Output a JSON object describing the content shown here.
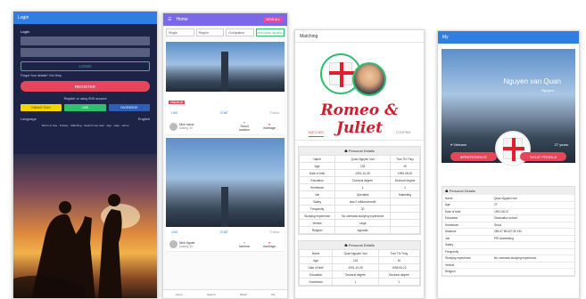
{
  "login": {
    "title": "Login",
    "form_label": "Login",
    "login_button": "LOGIN",
    "forgot_text": "Forgot Your details? Get Help",
    "register_button": "REGISTER",
    "or_text": "Register or using SNS account",
    "social": [
      {
        "label": "KAKAO TALK",
        "color": "#f5d400"
      },
      {
        "label": "LINE",
        "color": "#2fbf71"
      },
      {
        "label": "FACEBOOK",
        "color": "#2f5fb3"
      }
    ],
    "language_label": "Language",
    "language_value": "English",
    "links_text": "Terms of Use · Privacy · Matching · Search Live Cam · App · Help · Home"
  },
  "home": {
    "title": "Home",
    "top_button": "VIEW ALL",
    "filters": [
      "Single",
      "Region",
      "Occupation"
    ],
    "search_button": "MATCHING SEARCH",
    "cards": [
      {
        "tag": "PREMIUM",
        "like": "LIKE",
        "chat": "CHAT",
        "follow": "Follow",
        "user": "Nick name",
        "user_sub": "Dating 30",
        "location": "Seoul",
        "location_sub": "location",
        "status": "marriage"
      },
      {
        "tag": "",
        "like": "LIKE",
        "chat": "CHAT",
        "follow": "Follow",
        "user": "Nick Agosti",
        "user_sub": "Dating 30",
        "location": "Incheon",
        "location_sub": "location",
        "status": "marriage"
      }
    ],
    "bottom_nav": [
      "Home",
      "Search",
      "Match",
      "My"
    ]
  },
  "matching": {
    "title": "Matching",
    "headline": "Romeo & Juliet",
    "tabs": [
      "MATCHED",
      "REQUESTED",
      "CONFIRM"
    ],
    "section_title": "Personal Details",
    "rows": [
      [
        "Name",
        "Quan Nguyen Van",
        "Tran Thi Thuy"
      ],
      [
        "Age",
        "133",
        "20"
      ],
      [
        "Date of birth",
        "1991-10-05",
        "1995-08-22"
      ],
      [
        "Education",
        "Doctoral degree",
        "Doctoral degree"
      ],
      [
        "Hometown",
        "1",
        "1"
      ],
      [
        "Job",
        "Operative",
        "Marketing"
      ],
      [
        "Salary",
        "less 2 millions/month",
        ""
      ],
      [
        "Frequently",
        "30",
        ""
      ],
      [
        "Studying experience",
        "No overseas studying experience",
        ""
      ],
      [
        "Vehicle",
        "Large",
        ""
      ],
      [
        "Religion",
        "Agnostic",
        ""
      ]
    ],
    "section2_title": "Personal Details",
    "rows2": [
      [
        "Name",
        "Quan Nguyen Van",
        "Tran Thi Thuy"
      ],
      [
        "Age",
        "133",
        "20"
      ],
      [
        "Date of birth",
        "1991-10-05",
        "1995-08-22"
      ],
      [
        "Education",
        "Doctoral degree",
        "Doctoral degree"
      ],
      [
        "Hometown",
        "1",
        "1"
      ]
    ]
  },
  "profile": {
    "title": "My",
    "name": "Nguyen van Quan",
    "subtitle": "Nguyen",
    "location": "Vietnam",
    "age_badge": "27 years",
    "pref_button": "PREFERENCE",
    "edit_button": "EDIT PROFILE",
    "details_title": "Personal Details",
    "rows": [
      [
        "Name",
        "Quan Nguyen van"
      ],
      [
        "Age",
        "27"
      ],
      [
        "Date of birth",
        "1991-08-07"
      ],
      [
        "Education",
        "Graduation school"
      ],
      [
        "Hometown",
        "Seoul"
      ],
      [
        "Distance",
        "265.67 MI/427.55 KM"
      ],
      [
        "Job",
        "PR/ Advertising"
      ],
      [
        "Salary",
        ""
      ],
      [
        "Frequently",
        ""
      ],
      [
        "Studying experience",
        "No overseas studying experience"
      ],
      [
        "Vehicle",
        ""
      ],
      [
        "Religion",
        ""
      ]
    ]
  }
}
